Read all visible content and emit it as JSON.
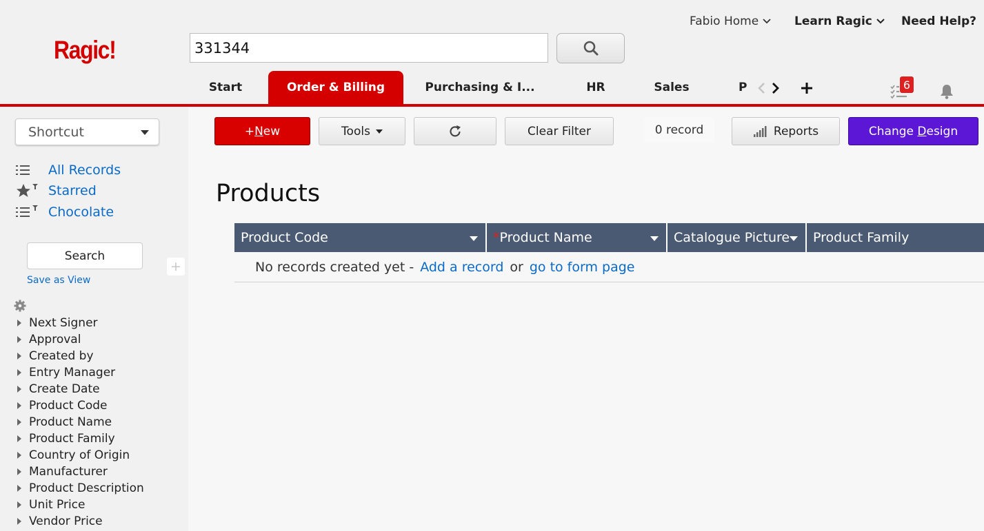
{
  "header": {
    "logo": "Ragic!",
    "search_value": "331344",
    "top_menu": {
      "home": "Fabio Home",
      "learn": "Learn Ragic",
      "help": "Need Help?"
    },
    "tabs": [
      {
        "label": "Start",
        "active": false
      },
      {
        "label": "Order & Billing",
        "active": true
      },
      {
        "label": "Purchasing & I...",
        "active": false
      },
      {
        "label": "HR",
        "active": false
      },
      {
        "label": "Sales",
        "active": false
      },
      {
        "label": "P",
        "active": false
      }
    ],
    "tasks_badge": "6",
    "colors": {
      "brand": "#d40000",
      "accent": "#5c16d6",
      "table_header": "#4b5a73",
      "link": "#0a6ac8"
    }
  },
  "sidebar": {
    "shortcut_label": "Shortcut",
    "views": [
      {
        "label": "All Records",
        "icon": "list-icon"
      },
      {
        "label": "Starred",
        "icon": "star-filter-icon"
      },
      {
        "label": "Chocolate",
        "icon": "list-filter-icon"
      }
    ],
    "search_label": "Search",
    "add_label": "+",
    "save_as_view": "Save as View",
    "filters": [
      "Next Signer",
      "Approval",
      "Created by",
      "Entry Manager",
      "Create Date",
      "Product Code",
      "Product Name",
      "Product Family",
      "Country of Origin",
      "Manufacturer",
      "Product Description",
      "Unit Price",
      "Vendor Price"
    ]
  },
  "toolbar": {
    "new_prefix": "+",
    "new_underlined": "N",
    "new_rest": "ew",
    "tools_label": "Tools",
    "clear_filter_label": "Clear Filter",
    "record_count": "0 record",
    "reports_label": "Reports",
    "change_design_pre": "Change ",
    "change_design_underlined": "D",
    "change_design_post": "esign"
  },
  "main": {
    "title": "Products",
    "columns": [
      {
        "label": "Product Code",
        "required": false
      },
      {
        "label": "Product Name",
        "required": true
      },
      {
        "label": "Catalogue Picture",
        "required": false
      },
      {
        "label": "Product Family",
        "required": false
      }
    ],
    "empty": {
      "text": "No records created yet -",
      "add_link": "Add a record",
      "or": "or",
      "form_link": "go to form page"
    }
  }
}
